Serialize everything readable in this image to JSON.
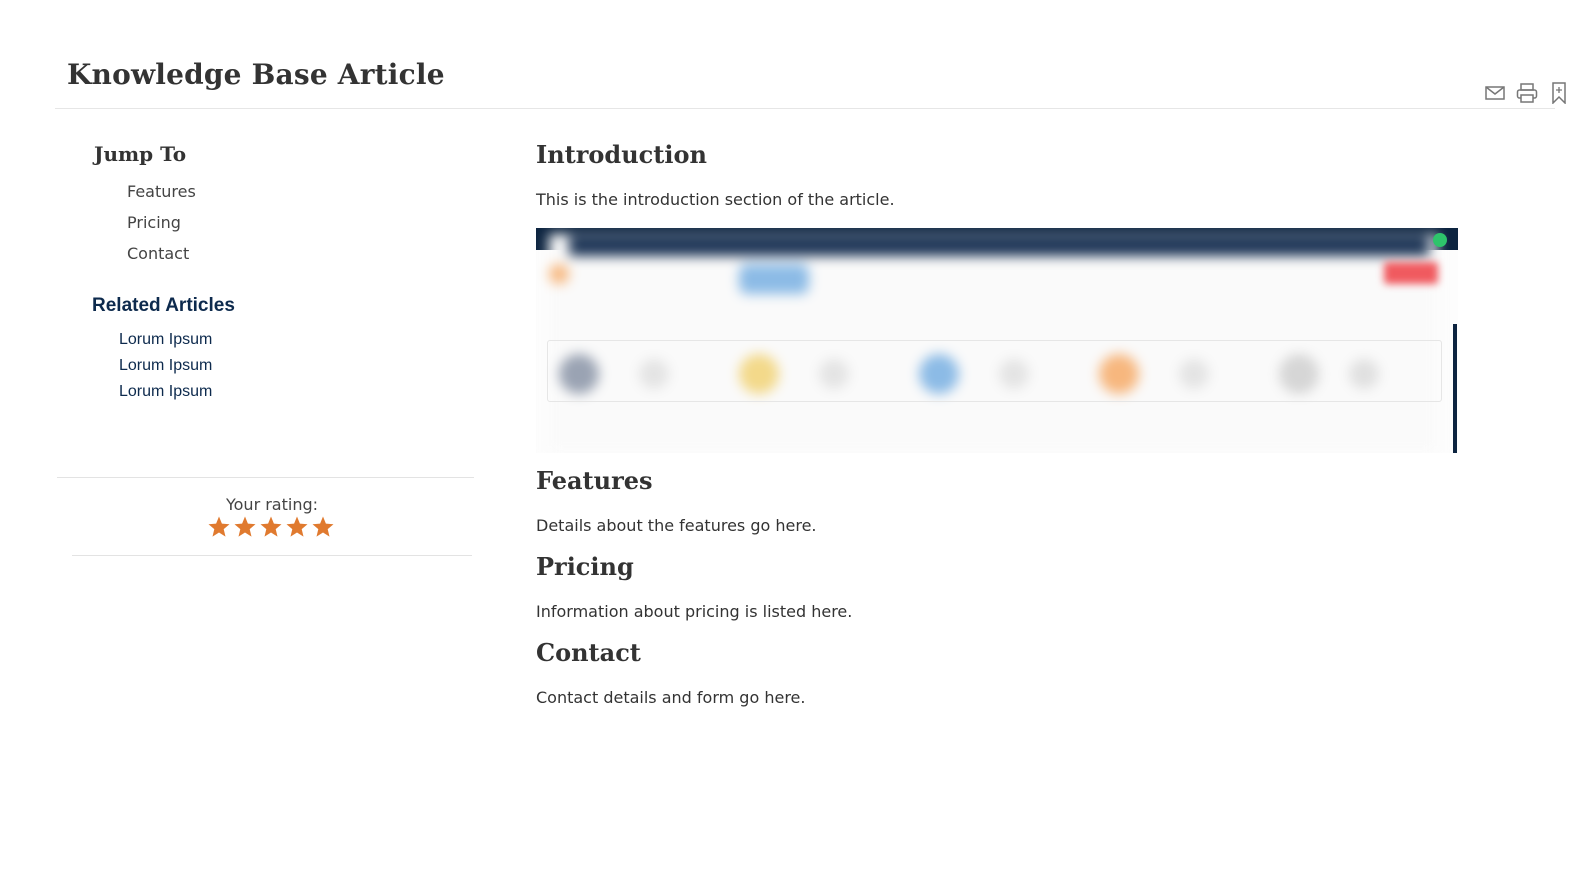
{
  "header": {
    "title": "Knowledge Base Article",
    "actions": [
      {
        "name": "email",
        "icon": "email-icon"
      },
      {
        "name": "print",
        "icon": "print-icon"
      },
      {
        "name": "bookmark",
        "icon": "bookmark-icon"
      }
    ]
  },
  "sidebar": {
    "jump_title": "Jump To",
    "jump_links": [
      "Features",
      "Pricing",
      "Contact"
    ],
    "related_title": "Related Articles",
    "related_links": [
      "Lorum Ipsum",
      "Lorum Ipsum",
      "Lorum Ipsum"
    ],
    "rating": {
      "label": "Your rating:",
      "value": 5,
      "max": 5,
      "star_color": "#e07a2f"
    }
  },
  "content": {
    "sections": [
      {
        "heading": "Introduction",
        "text": "This is the introduction section of the article."
      },
      {
        "heading": "Features",
        "text": "Details about the features go here."
      },
      {
        "heading": "Pricing",
        "text": "Information about pricing is listed here."
      },
      {
        "heading": "Contact",
        "text": "Contact details and form go here."
      }
    ]
  },
  "colors": {
    "accent_navy": "#0d2a4d",
    "text": "#333333",
    "star": "#e07a2f"
  }
}
